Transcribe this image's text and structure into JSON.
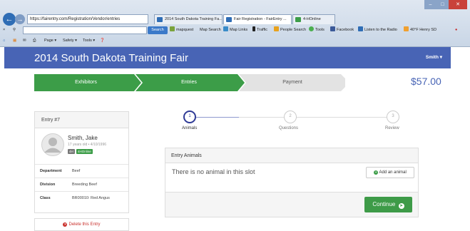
{
  "browser": {
    "url": "https://fairentry.com/Registration/Vendor/entries",
    "search_go": "Search",
    "tabs": [
      {
        "label": "2014 South Dakota Training Fa...",
        "active": false
      },
      {
        "label": "Fair Registration - FairEntry ...",
        "active": true
      },
      {
        "label": "4-HOnline",
        "active": false
      }
    ],
    "toolbar_items": [
      "mapquest",
      "Map Search",
      "Map Links",
      "Traffic",
      "People Search",
      "Tools",
      "Facebook",
      "Listen to the Radio",
      "40°F Henry SD"
    ],
    "command_items": [
      "Page ▾",
      "Safety ▾",
      "Tools ▾"
    ]
  },
  "header": {
    "title": "2014 South Dakota Training Fair",
    "user": "Smith ▾"
  },
  "wizard": {
    "steps": [
      {
        "label": "Exhibitors",
        "state": "done"
      },
      {
        "label": "Entries",
        "state": "current"
      },
      {
        "label": "Payment",
        "state": "todo"
      }
    ],
    "total": "$57.00"
  },
  "entry": {
    "heading": "Entry #7",
    "name": "Smith, Jake",
    "age_line": "17 years old • 4/10/1996",
    "badge1": "4H",
    "badge2": "4HOnline",
    "rows": [
      {
        "key": "Department",
        "value": "Beef"
      },
      {
        "key": "Division",
        "value": "Breeding Beef"
      },
      {
        "key": "Class",
        "value": "BR00010: Red Angus"
      }
    ],
    "delete_label": "Delete this Entry"
  },
  "progress": [
    {
      "num": "1",
      "label": "Animals",
      "active": true
    },
    {
      "num": "2",
      "label": "Questions",
      "active": false
    },
    {
      "num": "3",
      "label": "Review",
      "active": false
    }
  ],
  "animals": {
    "heading": "Entry Animals",
    "empty_text": "There is no animal in this slot",
    "add_label": "Add an animal",
    "continue_label": "Continue"
  },
  "colors": {
    "brand": "#4864b5",
    "step_green": "#3c9d48",
    "continue_green": "#3e9b48",
    "active_step": "#2f3a96",
    "danger": "#c9302c"
  }
}
